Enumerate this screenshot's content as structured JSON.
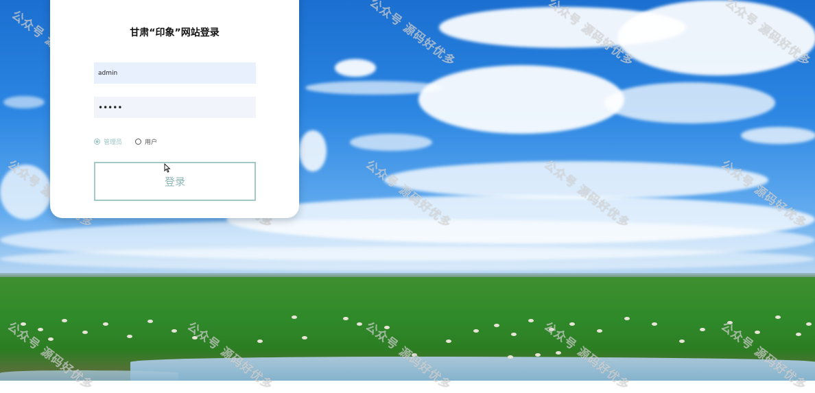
{
  "login": {
    "title": "甘肃“印象”网站登录",
    "username_value": "admin",
    "password_mask": "•••••",
    "roles": [
      {
        "label": "管理员",
        "checked": true
      },
      {
        "label": "用户",
        "checked": false
      }
    ],
    "submit_label": "登录"
  },
  "watermark": {
    "text": "公众号 源码好优多"
  },
  "colors": {
    "accent": "#9cc4c4",
    "username_bg": "#e8f0fe",
    "password_bg": "#f1f4fb"
  },
  "icons": {
    "cursor": "mouse-pointer-icon"
  }
}
